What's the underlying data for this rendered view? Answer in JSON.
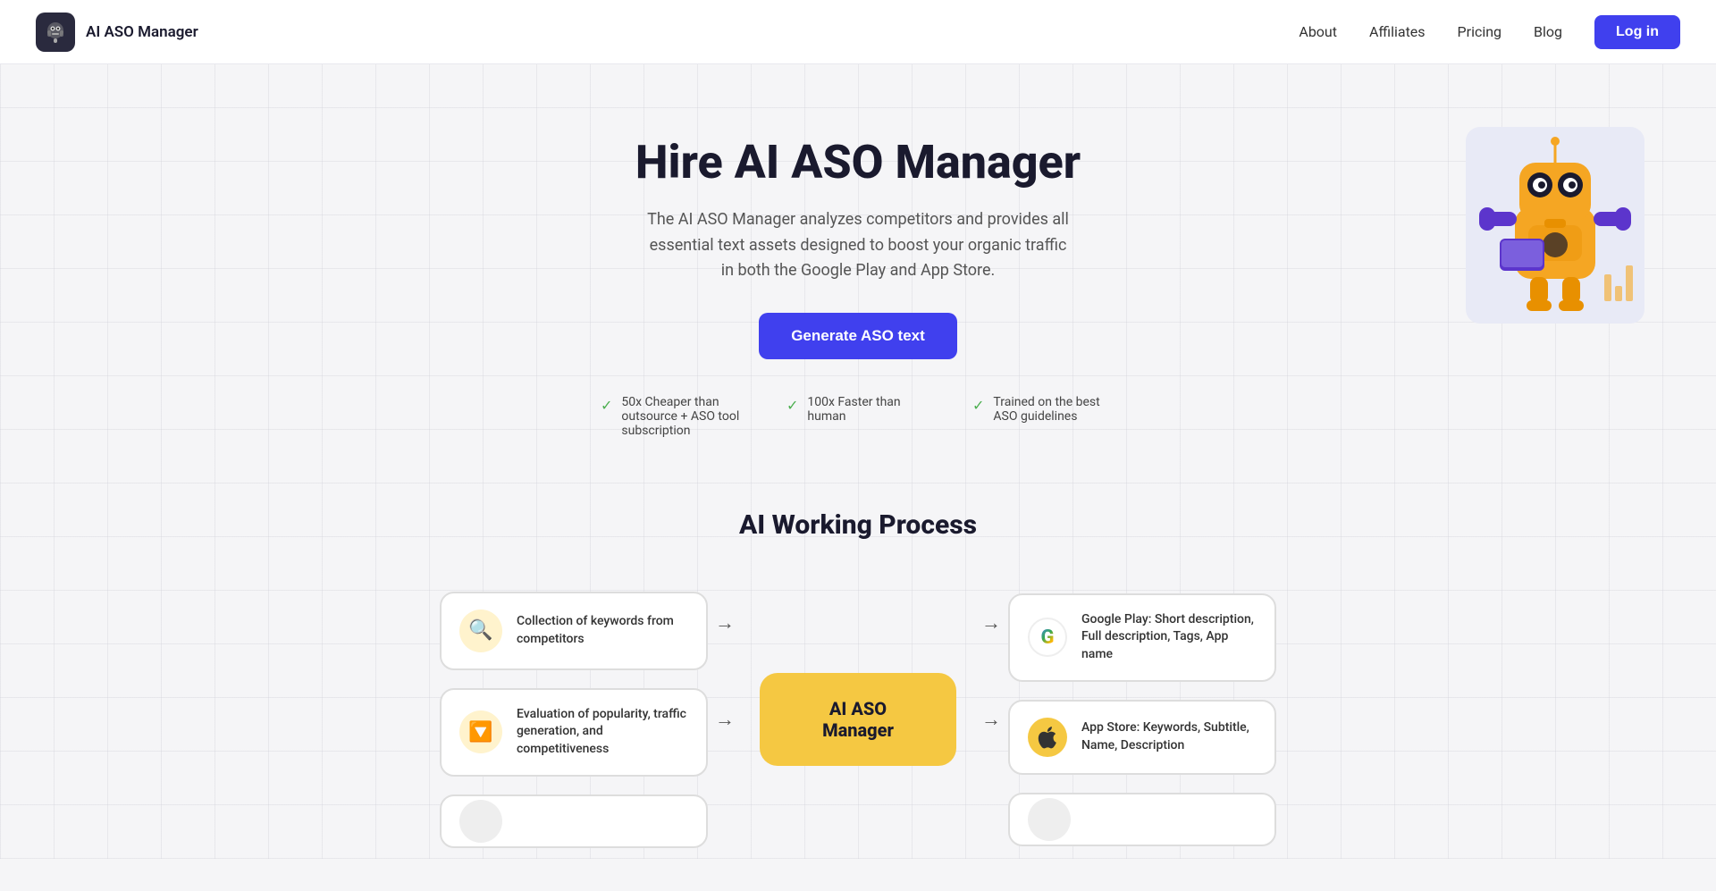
{
  "header": {
    "logo_text": "AI ASO Manager",
    "nav": {
      "about": "About",
      "affiliates": "Affiliates",
      "pricing": "Pricing",
      "blog": "Blog",
      "login": "Log in"
    }
  },
  "hero": {
    "title": "Hire AI ASO Manager",
    "subtitle": "The AI ASO Manager analyzes competitors and provides all essential text assets designed to boost your organic traffic in both the Google Play and App Store.",
    "cta": "Generate ASO text",
    "features": [
      {
        "text": "50x Cheaper than outsource + ASO tool subscription"
      },
      {
        "text": "100x Faster than human"
      },
      {
        "text": "Trained on the best ASO guidelines"
      }
    ]
  },
  "process": {
    "title": "AI Working Process",
    "inputs": [
      {
        "icon": "🔍",
        "text": "Collection of keywords from competitors"
      },
      {
        "icon": "🔽",
        "text": "Evaluation of popularity, traffic generation, and competitiveness"
      },
      {
        "icon": "",
        "text": ""
      }
    ],
    "center": "AI ASO Manager",
    "outputs": [
      {
        "icon": "G",
        "text": "Google Play: Short description, Full description, Tags, App name"
      },
      {
        "icon": "🍎",
        "text": "App Store: Keywords, Subtitle, Name, Description"
      },
      {
        "icon": "",
        "text": ""
      }
    ]
  }
}
